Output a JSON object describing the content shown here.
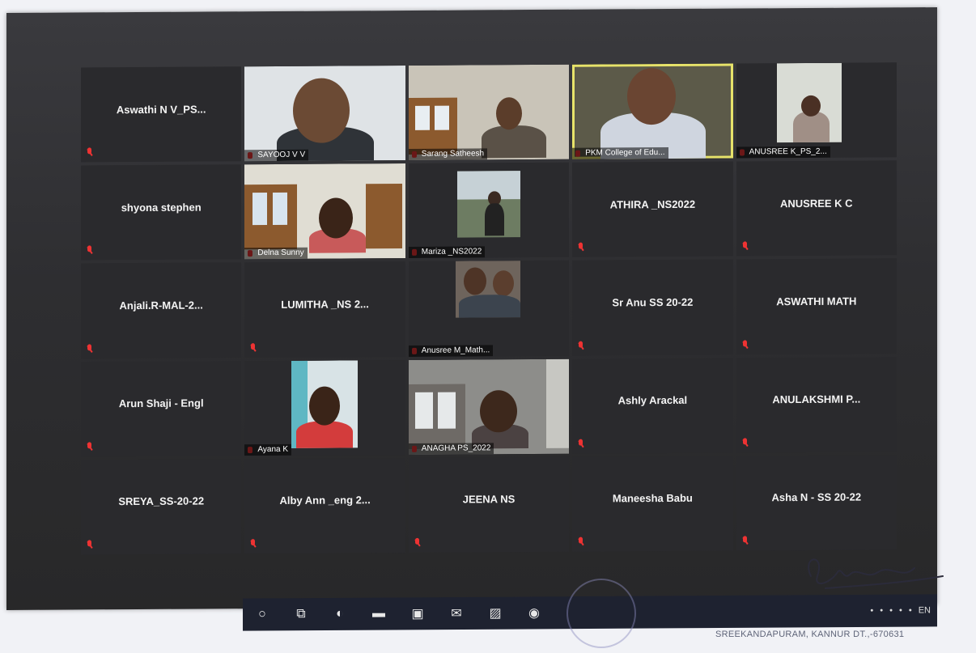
{
  "participants": [
    {
      "name": "Aswathi N V_PS...",
      "video": false
    },
    {
      "name": "SAYOOJ V V",
      "video": true,
      "scene": "man-bearded"
    },
    {
      "name": "Sarang Satheesh",
      "video": true,
      "scene": "man-room"
    },
    {
      "name": "PKM College of Edu...",
      "video": true,
      "scene": "man-glasses",
      "active": true
    },
    {
      "name": "ANUSREE K_PS_2...",
      "video": true,
      "scene": "woman-small"
    },
    {
      "name": "shyona stephen",
      "video": false
    },
    {
      "name": "Delna Sunny",
      "video": true,
      "scene": "woman-window"
    },
    {
      "name": "Mariza _NS2022",
      "video": true,
      "scene": "outdoor-small"
    },
    {
      "name": "ATHIRA _NS2022",
      "video": false
    },
    {
      "name": "ANUSREE K C",
      "video": false
    },
    {
      "name": "Anjali.R-MAL-2...",
      "video": false
    },
    {
      "name": "LUMITHA _NS 2...",
      "video": false
    },
    {
      "name": "Anusree M_Math...",
      "video": true,
      "scene": "couple-small"
    },
    {
      "name": "Sr Anu SS 20-22",
      "video": false
    },
    {
      "name": "ASWATHI MATH",
      "video": false
    },
    {
      "name": "Arun Shaji - Engl",
      "video": false
    },
    {
      "name": "Ayana K",
      "video": true,
      "scene": "woman-red-small"
    },
    {
      "name": "ANAGHA PS_2022",
      "video": true,
      "scene": "woman-room"
    },
    {
      "name": "Ashly Arackal",
      "video": false
    },
    {
      "name": "ANULAKSHMI P...",
      "video": false
    },
    {
      "name": "SREYA_SS-20-22",
      "video": false
    },
    {
      "name": "Alby Ann _eng 2...",
      "video": false
    },
    {
      "name": "JEENA NS",
      "video": false
    },
    {
      "name": "Maneesha Babu",
      "video": false
    },
    {
      "name": "Asha N - SS 20-22",
      "video": false
    }
  ],
  "taskbar": {
    "items": [
      {
        "icon": "cortana-circle-icon",
        "glyph": "○"
      },
      {
        "icon": "task-view-icon",
        "glyph": "⧉"
      },
      {
        "icon": "edge-browser-icon",
        "glyph": "◐"
      },
      {
        "icon": "file-explorer-icon",
        "glyph": "▬"
      },
      {
        "icon": "store-icon",
        "glyph": "▣"
      },
      {
        "icon": "mail-icon",
        "glyph": "✉"
      },
      {
        "icon": "photos-icon",
        "glyph": "▨"
      },
      {
        "icon": "zoom-app-icon",
        "glyph": "◉"
      }
    ],
    "system_lang": "EN"
  },
  "stamp": {
    "text": "SREEKANDAPURAM, KANNUR DT.,-670631"
  },
  "colors": {
    "muted_mic": "#e33333",
    "active_speaker_border": "#e7e36a",
    "tile_bg": "#2a2a2d",
    "taskbar_bg": "#1e2230"
  }
}
